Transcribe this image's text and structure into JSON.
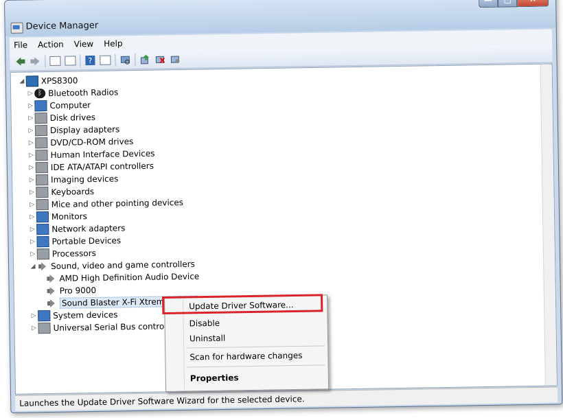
{
  "window": {
    "title": "Device Manager",
    "caption_buttons": {
      "minimize": "—",
      "maximize": "□",
      "close": "✕"
    }
  },
  "menubar": {
    "items": [
      "File",
      "Action",
      "View",
      "Help"
    ]
  },
  "toolbar": {
    "icons": [
      "back-icon",
      "forward-icon",
      "show-hide-console-tree-icon",
      "properties-icon",
      "help-icon",
      "view-icon",
      "scan-hardware-icon",
      "update-driver-icon",
      "uninstall-icon",
      "disable-icon"
    ]
  },
  "tree": {
    "root": "XPS8300",
    "categories": [
      {
        "label": "Bluetooth Radios",
        "icon": "bluetooth-icon"
      },
      {
        "label": "Computer",
        "icon": "computer-icon"
      },
      {
        "label": "Disk drives",
        "icon": "disk-drive-icon"
      },
      {
        "label": "Display adapters",
        "icon": "display-adapter-icon"
      },
      {
        "label": "DVD/CD-ROM drives",
        "icon": "dvd-drive-icon"
      },
      {
        "label": "Human Interface Devices",
        "icon": "hid-icon"
      },
      {
        "label": "IDE ATA/ATAPI controllers",
        "icon": "ide-controller-icon"
      },
      {
        "label": "Imaging devices",
        "icon": "imaging-device-icon"
      },
      {
        "label": "Keyboards",
        "icon": "keyboard-icon"
      },
      {
        "label": "Mice and other pointing devices",
        "icon": "mouse-icon"
      },
      {
        "label": "Monitors",
        "icon": "monitor-icon"
      },
      {
        "label": "Network adapters",
        "icon": "network-adapter-icon"
      },
      {
        "label": "Portable Devices",
        "icon": "portable-device-icon"
      },
      {
        "label": "Processors",
        "icon": "processor-icon"
      },
      {
        "label": "Sound, video and game controllers",
        "icon": "speaker-icon"
      }
    ],
    "sound_children": [
      "AMD High Definition Audio Device",
      "Pro 9000",
      "Sound Blaster X-Fi Xtreme Audio"
    ],
    "after": [
      {
        "label": "System devices",
        "icon": "system-device-icon"
      },
      {
        "label": "Universal Serial Bus controlle",
        "icon": "usb-icon"
      }
    ]
  },
  "context_menu": {
    "update": "Update Driver Software...",
    "disable": "Disable",
    "uninstall": "Uninstall",
    "scan": "Scan for hardware changes",
    "properties": "Properties"
  },
  "statusbar": {
    "text": "Launches the Update Driver Software Wizard for the selected device."
  }
}
